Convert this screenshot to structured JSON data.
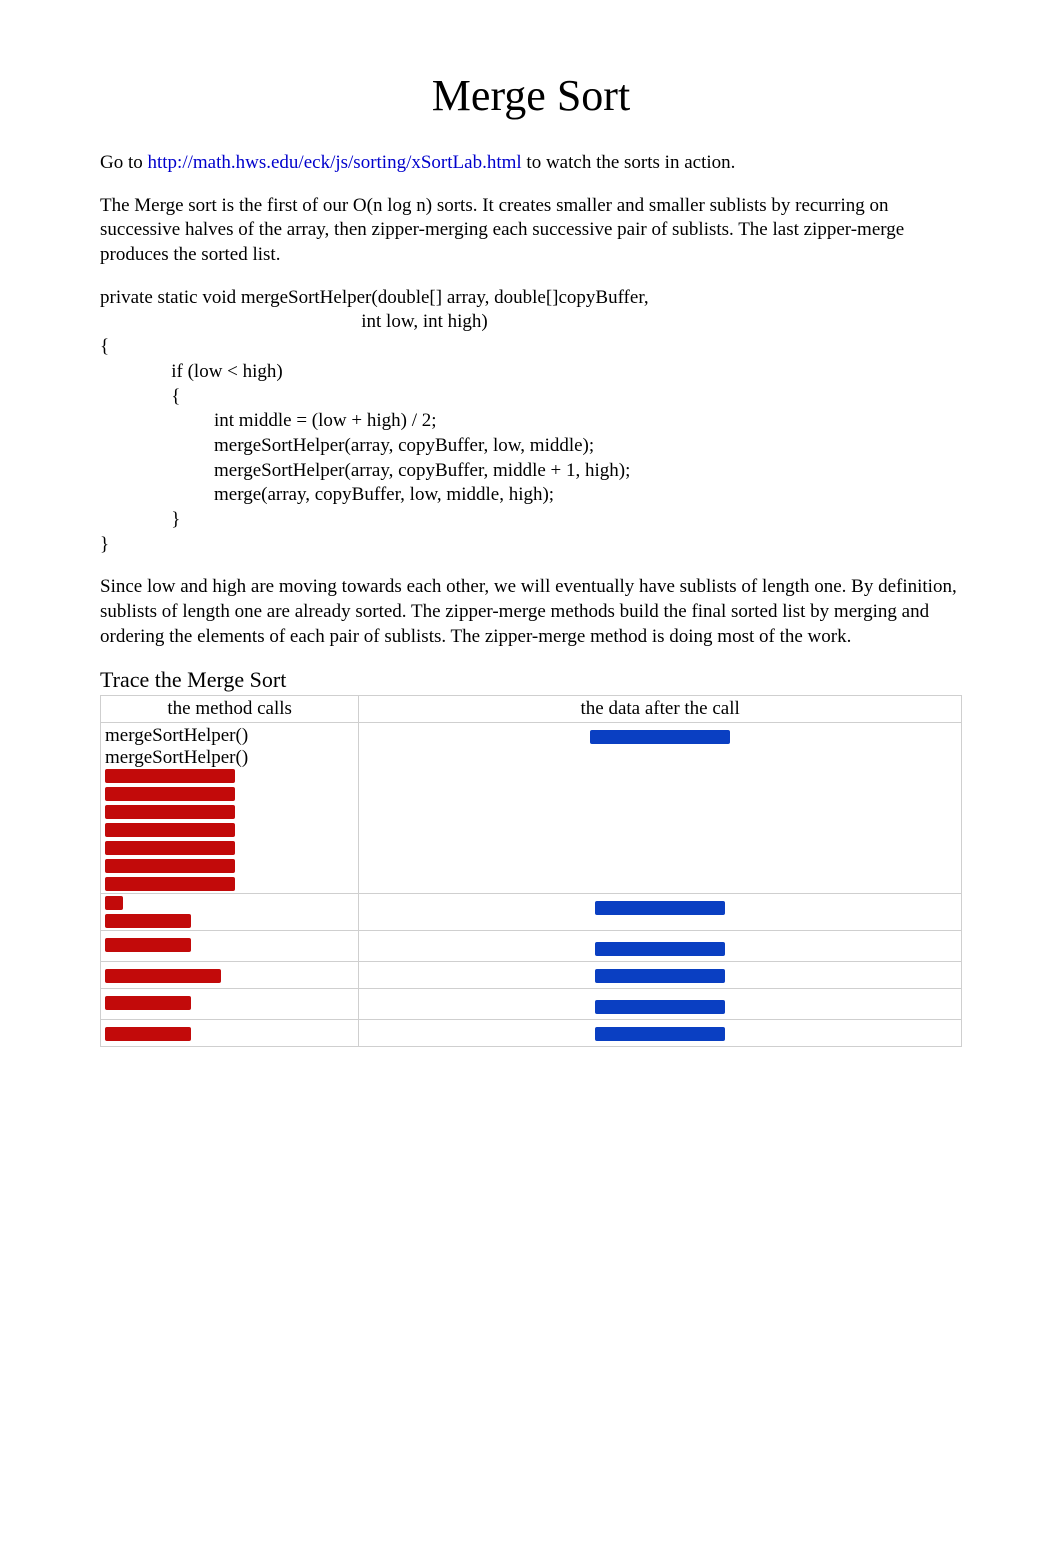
{
  "title": "Merge Sort",
  "intro": {
    "go_to_prefix": "Go to ",
    "link_text": "http://math.hws.edu/eck/js/sorting/xSortLab.html",
    "link_href": "http://math.hws.edu/eck/js/sorting/xSortLab.html",
    "go_to_suffix": " to watch the sorts in action."
  },
  "para_description": "The Merge sort is the first of our O(n log n) sorts.  It creates smaller and smaller sublists by recurring on successive halves of the array, then zipper-merging each successive pair of sublists.   The last zipper-merge produces the sorted list.",
  "code": "private static void mergeSortHelper(double[] array, double[]copyBuffer,\n                                                       int low, int high)\n{\n               if (low < high)\n               {\n                        int middle = (low + high) / 2;\n                        mergeSortHelper(array, copyBuffer, low, middle);\n                        mergeSortHelper(array, copyBuffer, middle + 1, high);\n                        merge(array, copyBuffer, low, middle, high);\n               }\n}",
  "para_explain": "Since low  and high   are moving towards each other, we will eventually have sublists of length one.  By definition, sublists of length one are already sorted.  The zipper-merge methods build the final sorted list by merging and ordering the elements of each pair of sublists.  The zipper-merge method is doing most of the work.",
  "trace_heading": "Trace the Merge Sort",
  "table": {
    "header_left": "the method calls",
    "header_right": "the data after the call",
    "row1_left_a": "mergeSortHelper()",
    "row1_left_b": "mergeSortHelper()"
  }
}
